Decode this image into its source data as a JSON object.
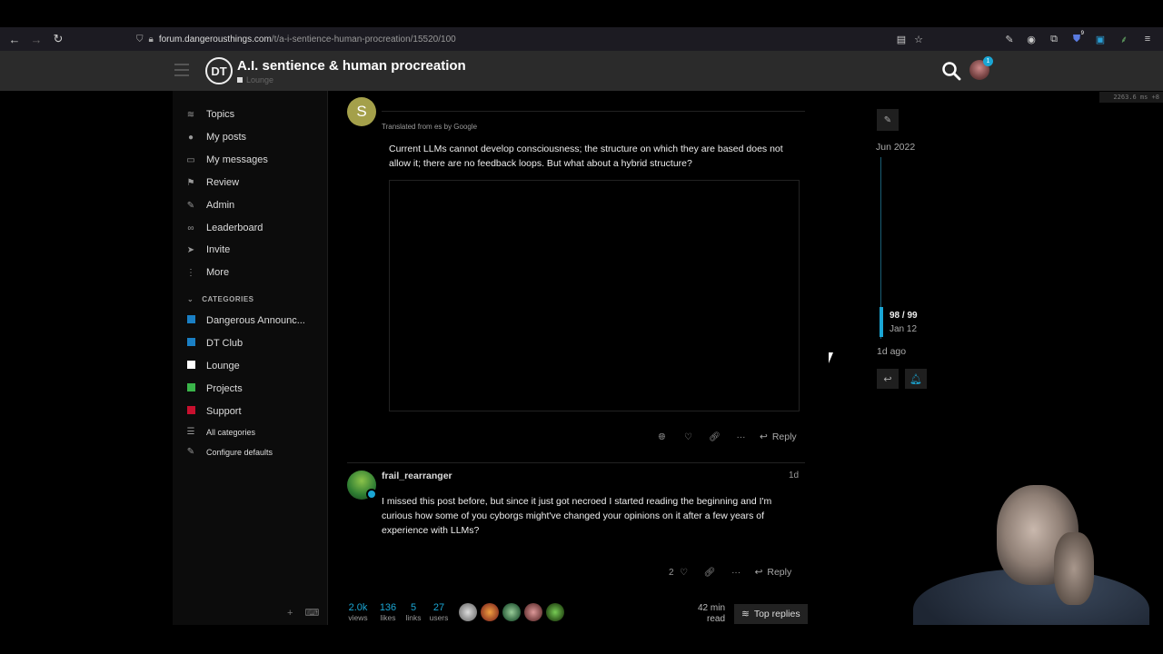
{
  "browser": {
    "url_host": "forum.dangerousthings.com",
    "url_path": "/t/a-i-sentience-human-procreation/15520/100",
    "ext_badge": "9"
  },
  "header": {
    "title": "A.I. sentience & human procreation",
    "category": "Lounge",
    "logo_text": "DT",
    "notification_count": "1"
  },
  "perf": "2263.6 ms +8",
  "sidebar": {
    "items": [
      {
        "label": "Topics",
        "icon": "layers-icon",
        "glyph": "≋"
      },
      {
        "label": "My posts",
        "icon": "user-icon",
        "glyph": "●"
      },
      {
        "label": "My messages",
        "icon": "inbox-icon",
        "glyph": "▭"
      },
      {
        "label": "Review",
        "icon": "flag-icon",
        "glyph": "⚑"
      },
      {
        "label": "Admin",
        "icon": "wrench-icon",
        "glyph": "✎"
      },
      {
        "label": "Leaderboard",
        "icon": "link-icon",
        "glyph": "∞"
      },
      {
        "label": "Invite",
        "icon": "send-icon",
        "glyph": "➤"
      },
      {
        "label": "More",
        "icon": "more-icon",
        "glyph": "⋮"
      }
    ],
    "categories_heading": "CATEGORIES",
    "categories": [
      {
        "label": "Dangerous Announc...",
        "color": "#1a7fc4"
      },
      {
        "label": "DT Club",
        "color": "#1a7fc4"
      },
      {
        "label": "Lounge",
        "color": "#ffffff"
      },
      {
        "label": "Projects",
        "color": "#3ab54a"
      },
      {
        "label": "Support",
        "color": "#c8102e"
      }
    ],
    "all_categories": "All categories",
    "configure_defaults": "Configure defaults"
  },
  "post1": {
    "avatar_letter": "S",
    "translated": "Translated from es by Google",
    "text_line1": "Current LLMs cannot develop consciousness; the structure on which they are based does not",
    "text_line2": "allow it; there are no feedback loops. But what about a hybrid structure?",
    "reply_label": "Reply"
  },
  "post2": {
    "username": "frail_rearranger",
    "date": "1d",
    "text_line1": "I missed this post before, but since it just got necroed I started reading the beginning and I'm",
    "text_line2": "curious how some of you cyborgs might've changed your opinions on it after a few years of",
    "text_line3": "experience with LLMs?",
    "like_count": "2",
    "reply_label": "Reply"
  },
  "topic_stats": {
    "views": {
      "n": "2.0k",
      "l": "views"
    },
    "likes": {
      "n": "136",
      "l": "likes"
    },
    "links": {
      "n": "5",
      "l": "links"
    },
    "users": {
      "n": "27",
      "l": "users"
    },
    "read_time_n": "42 min",
    "read_time_l": "read",
    "top_replies": "Top replies"
  },
  "timeline": {
    "start_date": "Jun 2022",
    "position": "98 / 99",
    "position_date": "Jan 12",
    "last_activity": "1d ago"
  }
}
